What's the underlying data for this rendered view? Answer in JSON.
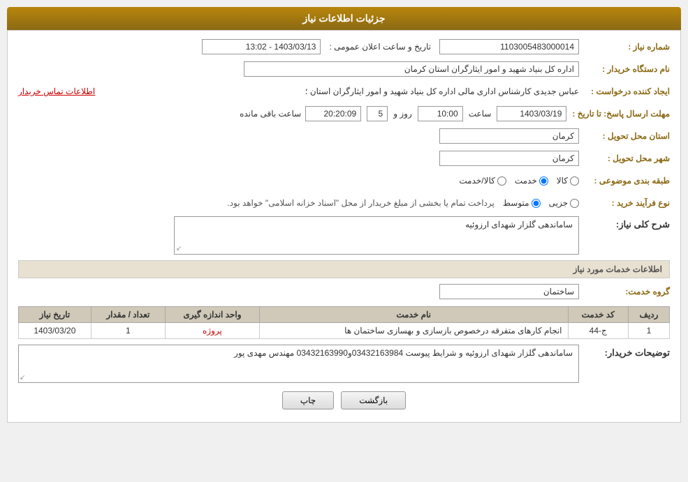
{
  "page": {
    "title": "جزئیات اطلاعات نیاز"
  },
  "header": {
    "title": "جزئیات اطلاعات نیاز"
  },
  "fields": {
    "need_number_label": "شماره نیاز :",
    "need_number_value": "1103005483000014",
    "announcement_label": "تاریخ و ساعت اعلان عمومی :",
    "announcement_value": "1403/03/13 - 13:02",
    "buyer_org_label": "نام دستگاه خریدار :",
    "buyer_org_value": "اداره کل بنیاد شهید و امور ایثارگران استان کرمان",
    "requester_label": "ایجاد کننده درخواست :",
    "requester_value": "عباس جدیدی کارشناس اداری مالی اداره کل بنیاد شهید و امور ایثارگران استان ؛",
    "requester_link": "اطلاعات تماس خریدار",
    "deadline_label": "مهلت ارسال پاسخ: تا تاریخ :",
    "deadline_date": "1403/03/19",
    "deadline_time_label": "ساعت",
    "deadline_time": "10:00",
    "deadline_day_label": "روز و",
    "deadline_days": "5",
    "deadline_remaining_label": "ساعت باقی مانده",
    "deadline_remaining": "20:20:09",
    "province_label": "استان محل تحویل :",
    "province_value": "کرمان",
    "city_label": "شهر محل تحویل :",
    "city_value": "کرمان",
    "category_label": "طبقه بندی موضوعی :",
    "category_options": [
      {
        "label": "کالا",
        "value": "kala"
      },
      {
        "label": "خدمت",
        "value": "khedmat"
      },
      {
        "label": "کالا/خدمت",
        "value": "kala_khedmat"
      }
    ],
    "category_selected": "khedmat",
    "purchase_type_label": "نوع فرآیند خرید :",
    "purchase_type_note": "پرداخت تمام یا بخشی از مبلغ خریدار از محل \"اسناد خزانه اسلامی\" خواهد بود.",
    "purchase_type_options": [
      {
        "label": "جزیی",
        "value": "jozii"
      },
      {
        "label": "متوسط",
        "value": "motavasset"
      }
    ],
    "purchase_type_selected": "motavasset",
    "general_description_label": "شرح کلی نیاز:",
    "general_description_value": "ساماندهی گلزار شهدای ارزوئیه",
    "services_section_label": "اطلاعات خدمات مورد نیاز",
    "service_group_label": "گروه خدمت:",
    "service_group_value": "ساختمان",
    "table": {
      "headers": [
        "ردیف",
        "کد خدمت",
        "نام خدمت",
        "واحد اندازه گیری",
        "تعداد / مقدار",
        "تاریخ نیاز"
      ],
      "rows": [
        {
          "row": "1",
          "code": "ج-44",
          "name": "انجام کارهای متفرقه درخصوص بازسازی و بهسازی ساختمان ها",
          "unit": "پروژه",
          "quantity": "1",
          "date": "1403/03/20"
        }
      ]
    },
    "buyer_notes_label": "توضیحات خریدار:",
    "buyer_notes_value": "ساماندهی گلزار شهدای ارزوئیه و شرایط پیوست 03432163984و03432163990 مهندس مهدی پور"
  },
  "buttons": {
    "back_label": "بازگشت",
    "print_label": "چاپ"
  }
}
